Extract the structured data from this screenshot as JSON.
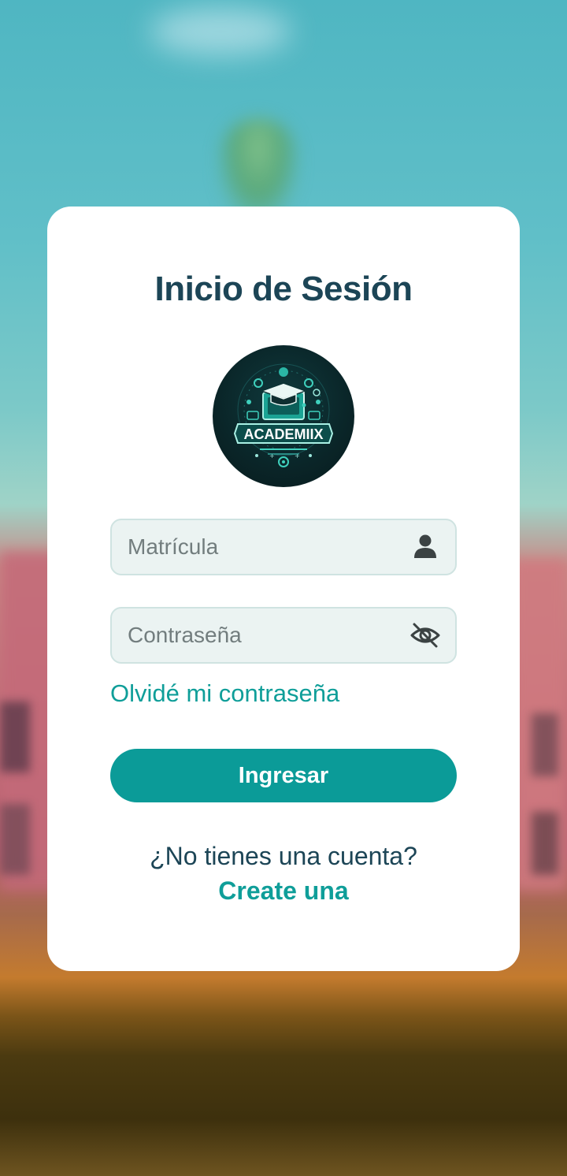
{
  "login": {
    "title": "Inicio de Sesión",
    "logo_text": "ACADEMIIX",
    "username": {
      "placeholder": "Matrícula",
      "value": "",
      "icon": "user-icon"
    },
    "password": {
      "placeholder": "Contraseña",
      "value": "",
      "icon": "eye-off-icon"
    },
    "forgot_label": "Olvidé mi contraseña",
    "submit_label": "Ingresar",
    "no_account_text": "¿No tienes una cuenta?",
    "create_label": "Create una"
  },
  "colors": {
    "primary": "#0b9b98",
    "title": "#1c4556",
    "link": "#0f9e99",
    "field_bg": "#ebf3f2"
  }
}
